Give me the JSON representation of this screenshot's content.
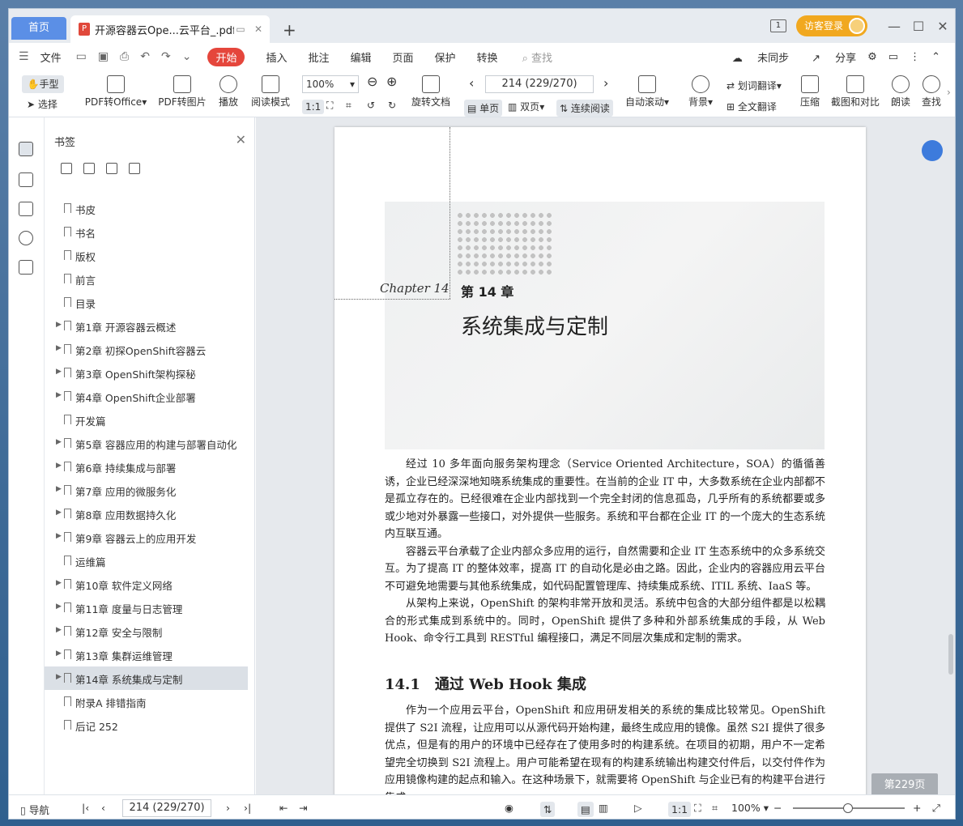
{
  "tabs": {
    "home": "首页",
    "doc_title": "开源容器云Ope...云平台_.pdf",
    "add": "+"
  },
  "window": {
    "notify_badge": "1",
    "login_label": "访客登录",
    "minimize": "—",
    "maximize": "☐",
    "close": "✕"
  },
  "menu": {
    "file": "文件",
    "items": [
      "开始",
      "插入",
      "批注",
      "编辑",
      "页面",
      "保护",
      "转换"
    ],
    "search_placeholder": "查找",
    "sync": "未同步",
    "share": "分享"
  },
  "toolbar": {
    "hand": "手型",
    "select": "选择",
    "pdf_to_office": "PDF转Office",
    "pdf_to_image": "PDF转图片",
    "play": "播放",
    "read_mode": "阅读模式",
    "zoom": "100%",
    "rotate": "旋转文档",
    "page_value": "214 (229/270)",
    "single": "单页",
    "double": "双页",
    "continuous": "连续阅读",
    "auto_scroll": "自动滚动",
    "background": "背景",
    "word_translate": "划词翻译",
    "full_translate": "全文翻译",
    "compress": "压缩",
    "screenshot_compare": "截图和对比",
    "read_aloud": "朗读",
    "find": "查找"
  },
  "bookmarks": {
    "title": "书签",
    "items": [
      {
        "label": "书皮",
        "expandable": false
      },
      {
        "label": "书名",
        "expandable": false
      },
      {
        "label": "版权",
        "expandable": false
      },
      {
        "label": "前言",
        "expandable": false
      },
      {
        "label": "目录",
        "expandable": false
      },
      {
        "label": "第1章 开源容器云概述",
        "expandable": true
      },
      {
        "label": "第2章 初探OpenShift容器云",
        "expandable": true
      },
      {
        "label": "第3章 OpenShift架构探秘",
        "expandable": true
      },
      {
        "label": "第4章 OpenShift企业部署",
        "expandable": true
      },
      {
        "label": "开发篇",
        "expandable": false
      },
      {
        "label": "第5章 容器应用的构建与部署自动化",
        "expandable": true
      },
      {
        "label": "第6章 持续集成与部署",
        "expandable": true
      },
      {
        "label": "第7章 应用的微服务化",
        "expandable": true
      },
      {
        "label": "第8章 应用数据持久化",
        "expandable": true
      },
      {
        "label": "第9章 容器云上的应用开发",
        "expandable": true
      },
      {
        "label": "运维篇",
        "expandable": false
      },
      {
        "label": "第10章 软件定义网络",
        "expandable": true
      },
      {
        "label": "第11章 度量与日志管理",
        "expandable": true
      },
      {
        "label": "第12章 安全与限制",
        "expandable": true
      },
      {
        "label": "第13章 集群运维管理",
        "expandable": true
      },
      {
        "label": "第14章 系统集成与定制",
        "expandable": true
      },
      {
        "label": "附录A 排错指南",
        "expandable": false
      },
      {
        "label": "后记 252",
        "expandable": false
      }
    ],
    "selected_index": 20
  },
  "document": {
    "chapter_script": "Chapter 14",
    "chapter_number": "第 14 章",
    "chapter_title": "系统集成与定制",
    "paragraphs": [
      "经过 10 多年面向服务架构理念（Service Oriented Architecture，SOA）的循循善诱，企业已经深深地知晓系统集成的重要性。在当前的企业 IT 中，大多数系统在企业内部都不是孤立存在的。已经很难在企业内部找到一个完全封闭的信息孤岛，几乎所有的系统都要或多或少地对外暴露一些接口，对外提供一些服务。系统和平台都在企业 IT 的一个庞大的生态系统内互联互通。",
      "容器云平台承载了企业内部众多应用的运行，自然需要和企业 IT 生态系统中的众多系统交互。为了提高 IT 的整体效率，提高 IT 的自动化是必由之路。因此，企业内的容器应用云平台不可避免地需要与其他系统集成，如代码配置管理库、持续集成系统、ITIL 系统、IaaS 等。",
      "从架构上来说，OpenShift 的架构非常开放和灵活。系统中包含的大部分组件都是以松耦合的形式集成到系统中的。同时，OpenShift 提供了多种和外部系统集成的手段，从 Web Hook、命令行工具到 RESTful 编程接口，满足不同层次集成和定制的需求。"
    ],
    "section_number": "14.1",
    "section_title": "通过 Web Hook 集成",
    "section_paragraph": "作为一个应用云平台，OpenShift 和应用研发相关的系统的集成比较常见。OpenShift 提供了 S2I 流程，让应用可以从源代码开始构建，最终生成应用的镜像。虽然 S2I 提供了很多优点，但是有的用户的环境中已经存在了使用多时的构建系统。在项目的初期，用户不一定希望完全切换到 S2I 流程上。用户可能希望在现有的构建系统输出构建交付件后，以交付件作为应用镜像构建的起点和输入。在这种场景下，就需要将 OpenShift 与企业已有的构建平台进行集成。",
    "page_badge": "第229页"
  },
  "statusbar": {
    "nav": "导航",
    "page_value": "214 (229/270)",
    "zoom": "100%"
  }
}
